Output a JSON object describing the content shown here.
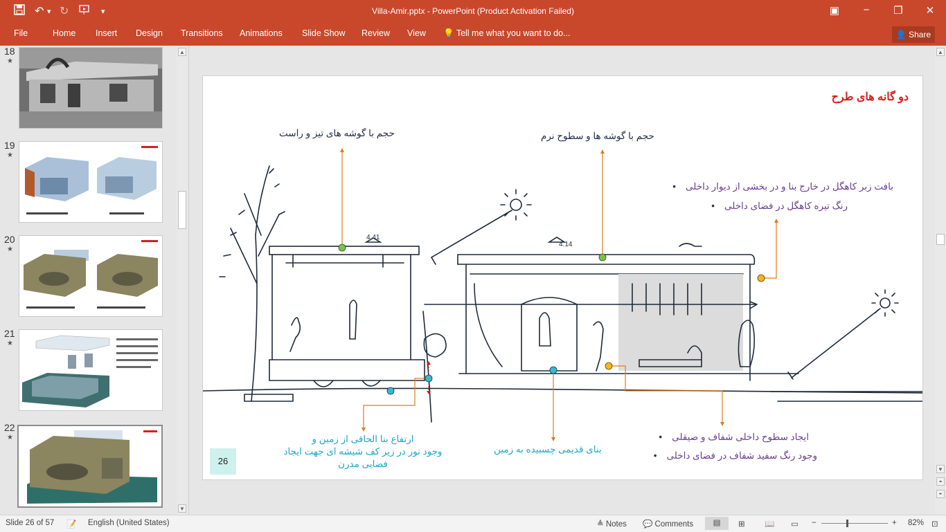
{
  "window": {
    "title": "Villa-Amir.pptx - PowerPoint (Product Activation Failed)"
  },
  "ribbon": {
    "file": "File",
    "tabs": [
      "Home",
      "Insert",
      "Design",
      "Transitions",
      "Animations",
      "Slide Show",
      "Review",
      "View"
    ],
    "tell_me": "Tell me what you want to do...",
    "share": "Share"
  },
  "thumbnails": [
    {
      "num": "18",
      "star": "★"
    },
    {
      "num": "19",
      "star": "★"
    },
    {
      "num": "20",
      "star": "★"
    },
    {
      "num": "21",
      "star": "★"
    },
    {
      "num": "22",
      "star": "★"
    }
  ],
  "slide": {
    "title": "دو گانه های طرح",
    "label_sharp": "حجم با گوشه های تیز و راست",
    "label_soft": "حجم با گوشه ها و سطوح نرم",
    "bullets_top": [
      "بافت زبر کاهگل در خارج بنا و در بخشی از دیوار داخلی",
      "رنگ تیره کاهگل در فضای داخلی"
    ],
    "label_elevation": [
      "ارتفاع بنا الحاقی از زمین و",
      "وجود نور در زیر کف شیشه ای جهت ایجاد",
      "فضایی مدرن"
    ],
    "label_ground": "بنای قدیمی چسبیده به زمین",
    "bullets_bottom": [
      "ایجاد سطوح داخلی شفاف و صیقلی",
      "وجود رنگ سفید شفاف در فضای داخلی"
    ],
    "slide_number": "26",
    "sketch_dims": [
      "4.41",
      "4.14"
    ]
  },
  "status": {
    "slide_info": "Slide 26 of 57",
    "language": "English (United States)",
    "notes": "Notes",
    "comments": "Comments",
    "zoom": "82%"
  },
  "colors": {
    "ribbon": "#c9482b",
    "title_red": "#d81e1e",
    "purple": "#6a3d8f",
    "cyan": "#1ea6c9",
    "orange_line": "#e07b1a"
  }
}
